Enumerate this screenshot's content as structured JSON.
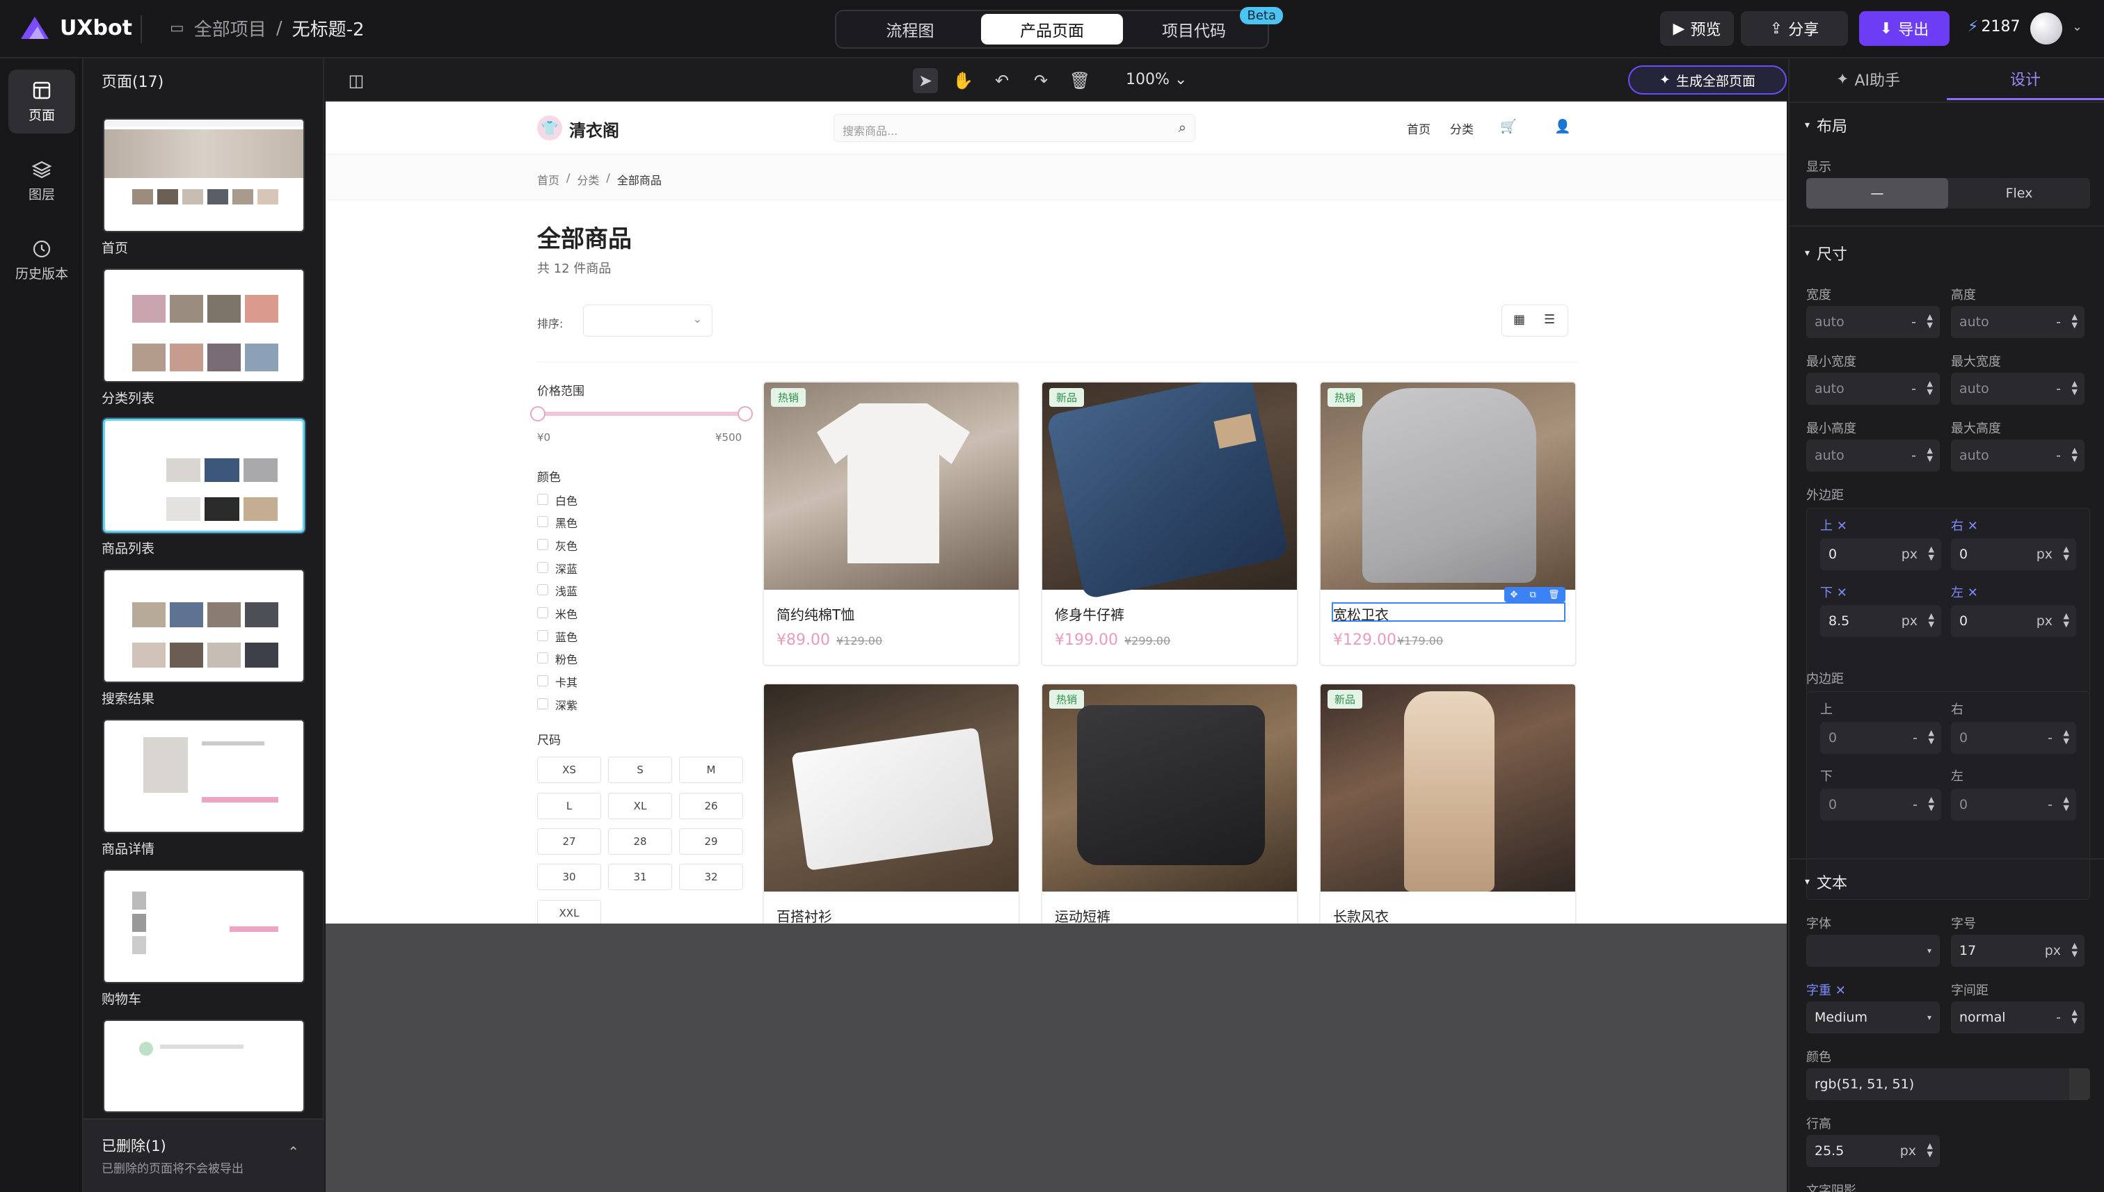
{
  "app": {
    "name": "UXbot"
  },
  "breadcrumb": {
    "root": "全部项目",
    "sep": "/",
    "current": "无标题-2"
  },
  "header_tabs": [
    {
      "label": "流程图",
      "active": false
    },
    {
      "label": "产品页面",
      "active": true
    },
    {
      "label": "项目代码",
      "active": false,
      "badge": "Beta"
    }
  ],
  "header_actions": {
    "preview": "预览",
    "share": "分享",
    "export": "导出",
    "credits": "2187"
  },
  "rail": [
    {
      "label": "页面",
      "icon": "layout-icon",
      "active": true
    },
    {
      "label": "图层",
      "icon": "layers-icon",
      "active": false
    },
    {
      "label": "历史版本",
      "icon": "history-icon",
      "active": false
    }
  ],
  "pages_panel": {
    "title": "页面(17)",
    "pages": [
      {
        "label": "首页",
        "active": false
      },
      {
        "label": "分类列表",
        "active": false
      },
      {
        "label": "商品列表",
        "active": true
      },
      {
        "label": "搜索结果",
        "active": false
      },
      {
        "label": "商品详情",
        "active": false
      },
      {
        "label": "购物车",
        "active": false
      },
      {
        "label": "",
        "active": false
      }
    ],
    "deleted_title": "已删除(1)",
    "deleted_note": "已删除的页面将不会被导出"
  },
  "canvas_toolbar": {
    "zoom": "100%",
    "generate": "生成全部页面"
  },
  "product_page": {
    "brand": "清衣阁",
    "search_placeholder": "搜索商品...",
    "nav": [
      "首页",
      "分类"
    ],
    "crumbs": [
      "首页",
      "分类",
      "全部商品"
    ],
    "title": "全部商品",
    "count": "共 12 件商品",
    "sort_label": "排序:",
    "price_filter": {
      "title": "价格范围",
      "min": "¥0",
      "max": "¥500"
    },
    "colors_title": "颜色",
    "colors": [
      "白色",
      "黑色",
      "灰色",
      "深蓝",
      "浅蓝",
      "米色",
      "蓝色",
      "粉色",
      "卡其",
      "深紫"
    ],
    "sizes_title": "尺码",
    "sizes": [
      "XS",
      "S",
      "M",
      "L",
      "XL",
      "26",
      "27",
      "28",
      "29",
      "30",
      "31",
      "32",
      "XXL"
    ],
    "products": [
      {
        "name": "简约纯棉T恤",
        "price": "¥89.00",
        "old": "¥129.00",
        "tag": "热销",
        "kind": "tshirt"
      },
      {
        "name": "修身牛仔裤",
        "price": "¥199.00",
        "old": "¥299.00",
        "tag": "新品",
        "kind": "jeans"
      },
      {
        "name": "宽松卫衣",
        "price": "¥129.00",
        "old": "¥179.00",
        "tag": "热销",
        "kind": "hoodie"
      },
      {
        "name": "百搭衬衫",
        "price": "",
        "old": "",
        "tag": "",
        "kind": "shirt"
      },
      {
        "name": "运动短裤",
        "price": "",
        "old": "",
        "tag": "热销",
        "kind": "shorts"
      },
      {
        "name": "长款风衣",
        "price": "",
        "old": "",
        "tag": "新品",
        "kind": "coat"
      }
    ]
  },
  "design_panel": {
    "tabs": [
      "AI助手",
      "设计"
    ],
    "layout": {
      "title": "布局",
      "display_label": "显示",
      "options": [
        "—",
        "Flex"
      ]
    },
    "size": {
      "title": "尺寸",
      "fields": [
        {
          "label": "宽度",
          "value": "auto",
          "unit": "-"
        },
        {
          "label": "高度",
          "value": "auto",
          "unit": "-"
        },
        {
          "label": "最小宽度",
          "value": "auto",
          "unit": "-"
        },
        {
          "label": "最大宽度",
          "value": "auto",
          "unit": "-"
        },
        {
          "label": "最小高度",
          "value": "auto",
          "unit": "-"
        },
        {
          "label": "最大高度",
          "value": "auto",
          "unit": "-"
        }
      ],
      "margin_label": "外边距",
      "margin": [
        {
          "label": "上",
          "value": "0",
          "unit": "px"
        },
        {
          "label": "右",
          "value": "0",
          "unit": "px"
        },
        {
          "label": "下",
          "value": "8.5",
          "unit": "px"
        },
        {
          "label": "左",
          "value": "0",
          "unit": "px"
        }
      ],
      "padding_label": "内边距",
      "padding": [
        {
          "label": "上",
          "value": "0",
          "unit": "-"
        },
        {
          "label": "右",
          "value": "0",
          "unit": "-"
        },
        {
          "label": "下",
          "value": "0",
          "unit": "-"
        },
        {
          "label": "左",
          "value": "0",
          "unit": "-"
        }
      ]
    },
    "text": {
      "title": "文本",
      "font_label": "字体",
      "font_value": "",
      "size_label": "字号",
      "size_value": "17",
      "size_unit": "px",
      "weight_label": "字重",
      "weight_value": "Medium",
      "spacing_label": "字间距",
      "spacing_value": "normal",
      "spacing_unit": "-",
      "color_label": "颜色",
      "color_value": "rgb(51, 51, 51)",
      "line_label": "行高",
      "line_value": "25.5",
      "line_unit": "px",
      "shadow_label": "文字阴影"
    }
  },
  "colors": {
    "accent": "#6d3cf5",
    "selection": "#3b82f6",
    "price": "#e79bbd",
    "active_thumb": "#63d2f5"
  }
}
